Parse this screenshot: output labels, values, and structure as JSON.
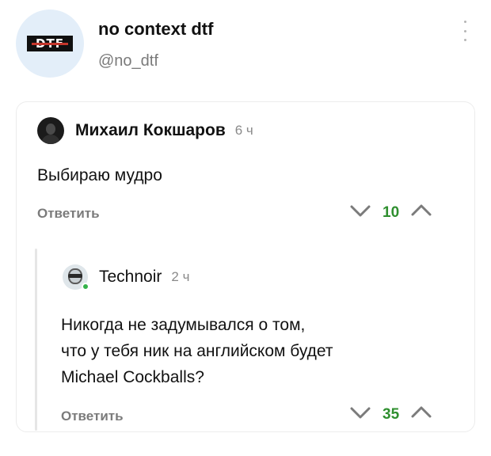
{
  "channel": {
    "logo_text": "DTF",
    "name": "no context dtf",
    "handle": "@no_dtf"
  },
  "comment": {
    "author": "Михаил Кокшаров",
    "time": "6 ч",
    "text": "Выбираю мудро",
    "reply_label": "Ответить",
    "score": "10"
  },
  "reply": {
    "author": "Technoir",
    "time": "2 ч",
    "text_lines": [
      "Никогда не задумывался о том,",
      "что у тебя ник на английском будет",
      "Michael Cockballs?"
    ],
    "reply_label": "Ответить",
    "score": "35"
  },
  "colors": {
    "score_positive": "#2f8f2f",
    "avatar_bg": "#e3eef9",
    "online_dot": "#34b24a"
  },
  "icons": {
    "menu": "more-vertical-icon",
    "downvote": "chevron-down-icon",
    "upvote": "chevron-up-icon"
  }
}
